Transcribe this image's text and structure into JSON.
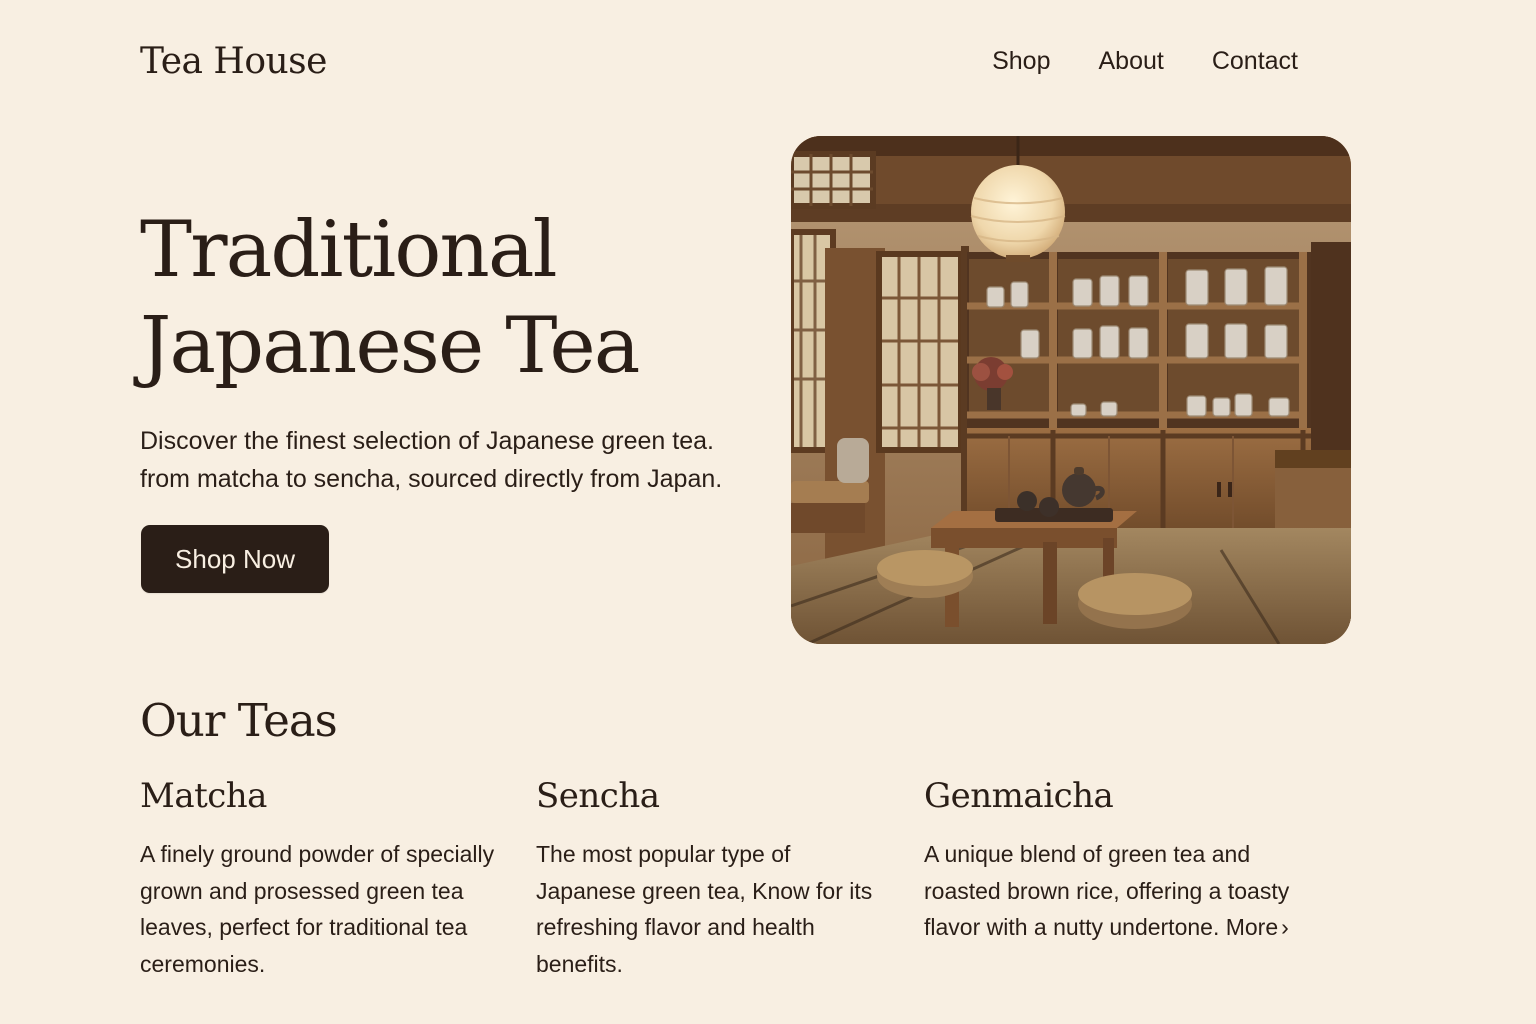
{
  "header": {
    "brand": "Tea House",
    "nav": [
      "Shop",
      "About",
      "Contact"
    ]
  },
  "hero": {
    "title_line1": "Traditional",
    "title_line2": "Japanese Tea",
    "subtitle_line1": "Discover the finest selection of Japanese green tea.",
    "subtitle_line2": "from matcha to sencha, sourced directly from Japan.",
    "cta": "Shop Now"
  },
  "teas": {
    "heading": "Our Teas",
    "items": [
      {
        "name": "Matcha",
        "description": "A finely ground powder of specially grown and prosessed green tea leaves, perfect for traditional tea ceremonies."
      },
      {
        "name": "Sencha",
        "description": "The most popular type of Japanese green tea, Know for its refreshing flavor and health benefits."
      },
      {
        "name": "Genmaicha",
        "description": "A unique blend of green tea and roasted brown rice, offering a toasty flavor with a nutty undertone.",
        "link": "More",
        "link_icon": "chevron-right-icon"
      }
    ]
  },
  "colors": {
    "background": "#f8efe2",
    "text": "#2a1e17",
    "button": "#2a1e17"
  }
}
